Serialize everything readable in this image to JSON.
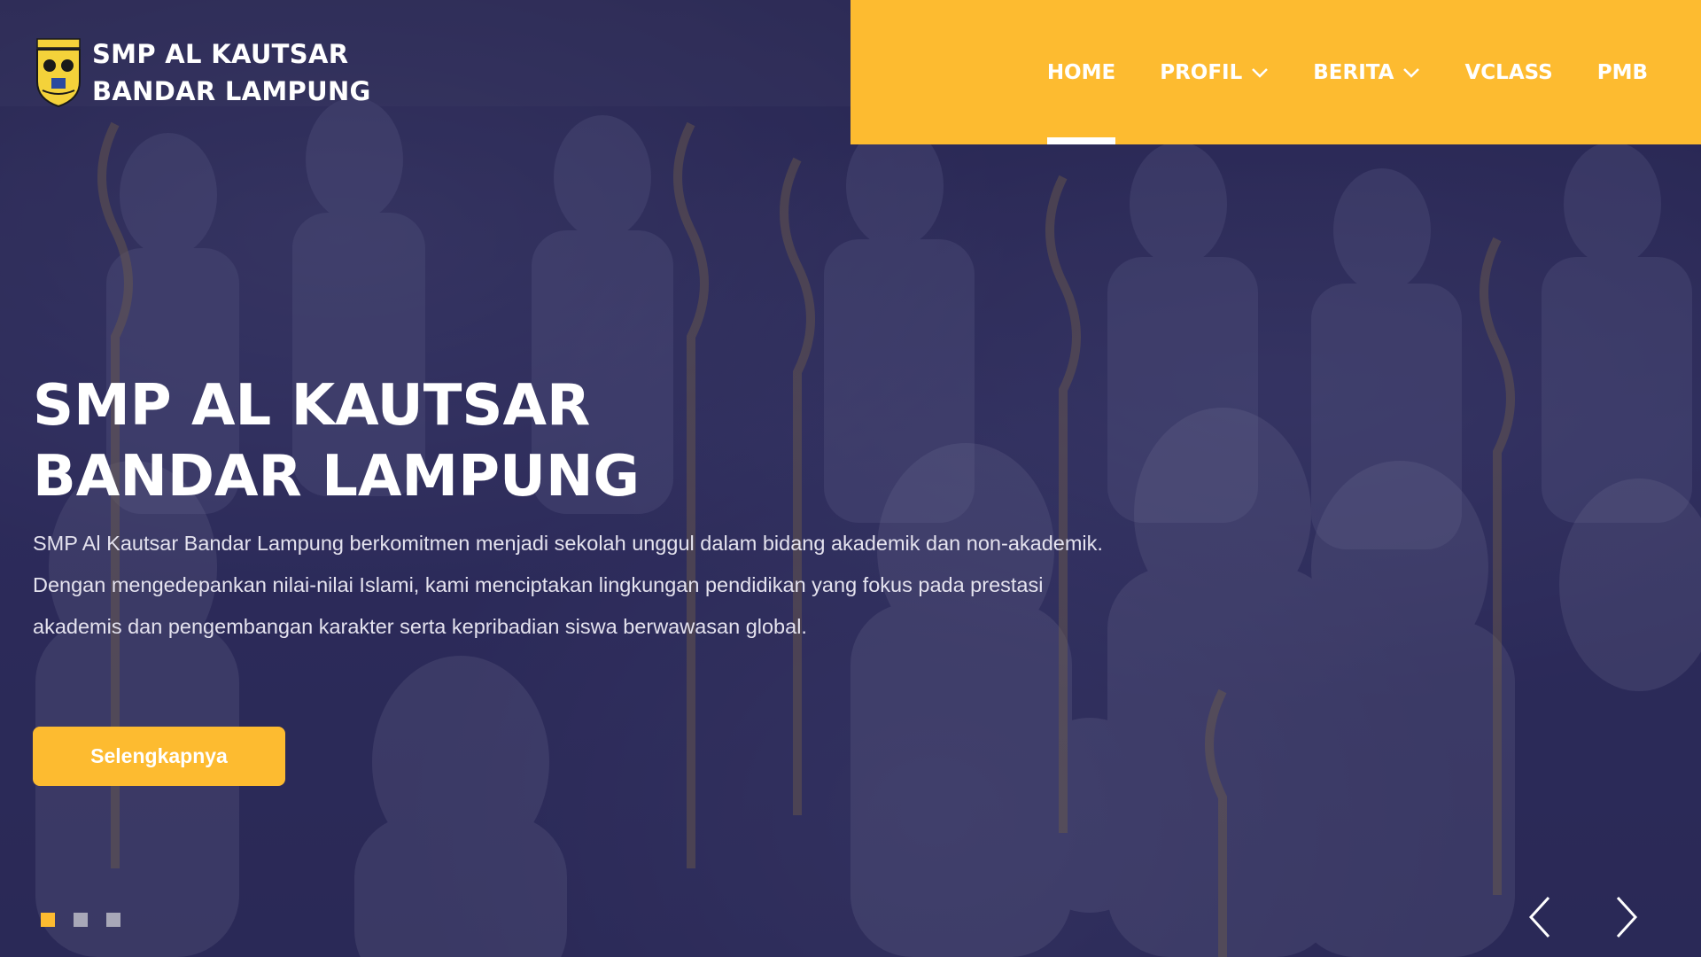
{
  "brand": {
    "line1": "SMP AL KAUTSAR",
    "line2": "BANDAR LAMPUNG",
    "logo_icon": "school-crest-icon"
  },
  "nav": {
    "items": [
      {
        "label": "HOME",
        "active": true,
        "dropdown": false
      },
      {
        "label": "PROFIL",
        "active": false,
        "dropdown": true
      },
      {
        "label": "BERITA",
        "active": false,
        "dropdown": true
      },
      {
        "label": "VCLASS",
        "active": false,
        "dropdown": false
      },
      {
        "label": "PMB",
        "active": false,
        "dropdown": false
      }
    ]
  },
  "hero": {
    "title_line1": "SMP AL KAUTSAR",
    "title_line2": "BANDAR LAMPUNG",
    "description": "SMP Al Kautsar Bandar Lampung berkomitmen menjadi sekolah unggul dalam bidang akademik dan non-akademik. Dengan mengedepankan nilai-nilai Islami, kami menciptakan lingkungan pendidikan yang fokus pada prestasi akademis dan pengembangan karakter serta kepribadian siswa berwawasan global.",
    "cta_label": "Selengkapnya"
  },
  "carousel": {
    "slides": 3,
    "active_slide": 1,
    "prev_icon": "chevron-left-icon",
    "next_icon": "chevron-right-icon"
  },
  "colors": {
    "accent": "#fdbb30",
    "overlay": "#232150"
  }
}
